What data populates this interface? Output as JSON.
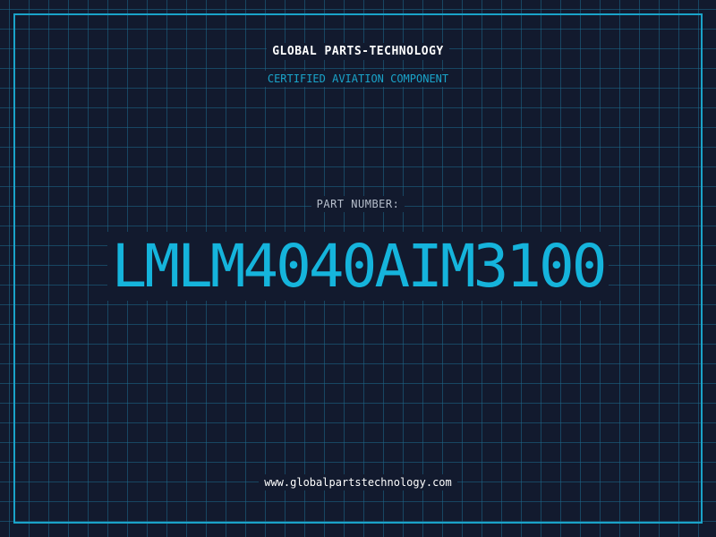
{
  "header": {
    "company": "GLOBAL PARTS-TECHNOLOGY",
    "subtitle": "CERTIFIED AVIATION COMPONENT"
  },
  "part": {
    "label": "PART NUMBER:",
    "number": "LMLM4040AIM3100"
  },
  "footer": {
    "website": "www.globalpartstechnology.com"
  },
  "colors": {
    "background": "#121a2e",
    "grid": "#1e698c",
    "accent": "#1aa3c9",
    "part_number": "#15b4dc",
    "text": "#ffffff"
  }
}
